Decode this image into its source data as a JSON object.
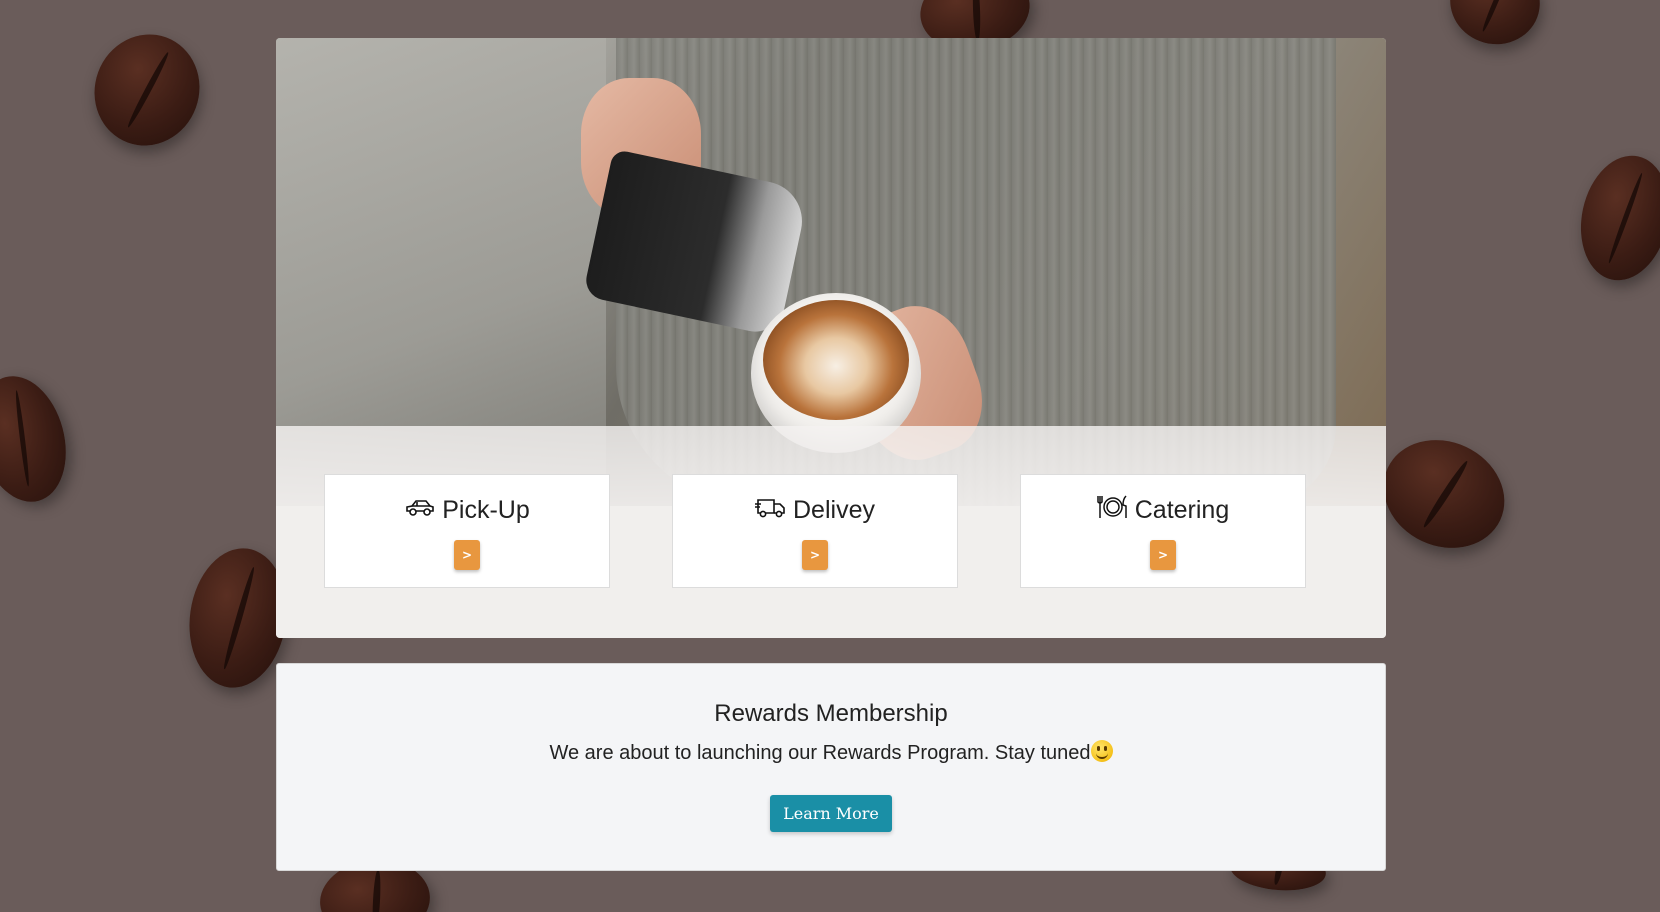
{
  "services": [
    {
      "label": "Pick-Up",
      "icon": "car-icon",
      "button": ">"
    },
    {
      "label": "Delivey",
      "icon": "truck-icon",
      "button": ">"
    },
    {
      "label": "Catering",
      "icon": "plate-cutlery-icon",
      "button": ">"
    }
  ],
  "rewards": {
    "title": "Rewards Membership",
    "text": "We are about to launching our Rewards Program. Stay tuned",
    "emoji": "smiling-face-icon",
    "button_label": "Learn More"
  },
  "colors": {
    "background": "#6a5c5a",
    "service_button": "#e8973f",
    "learn_button": "#1a8fa6",
    "rewards_panel": "#f4f5f7"
  },
  "hero_image": "barista-pouring-latte-art"
}
